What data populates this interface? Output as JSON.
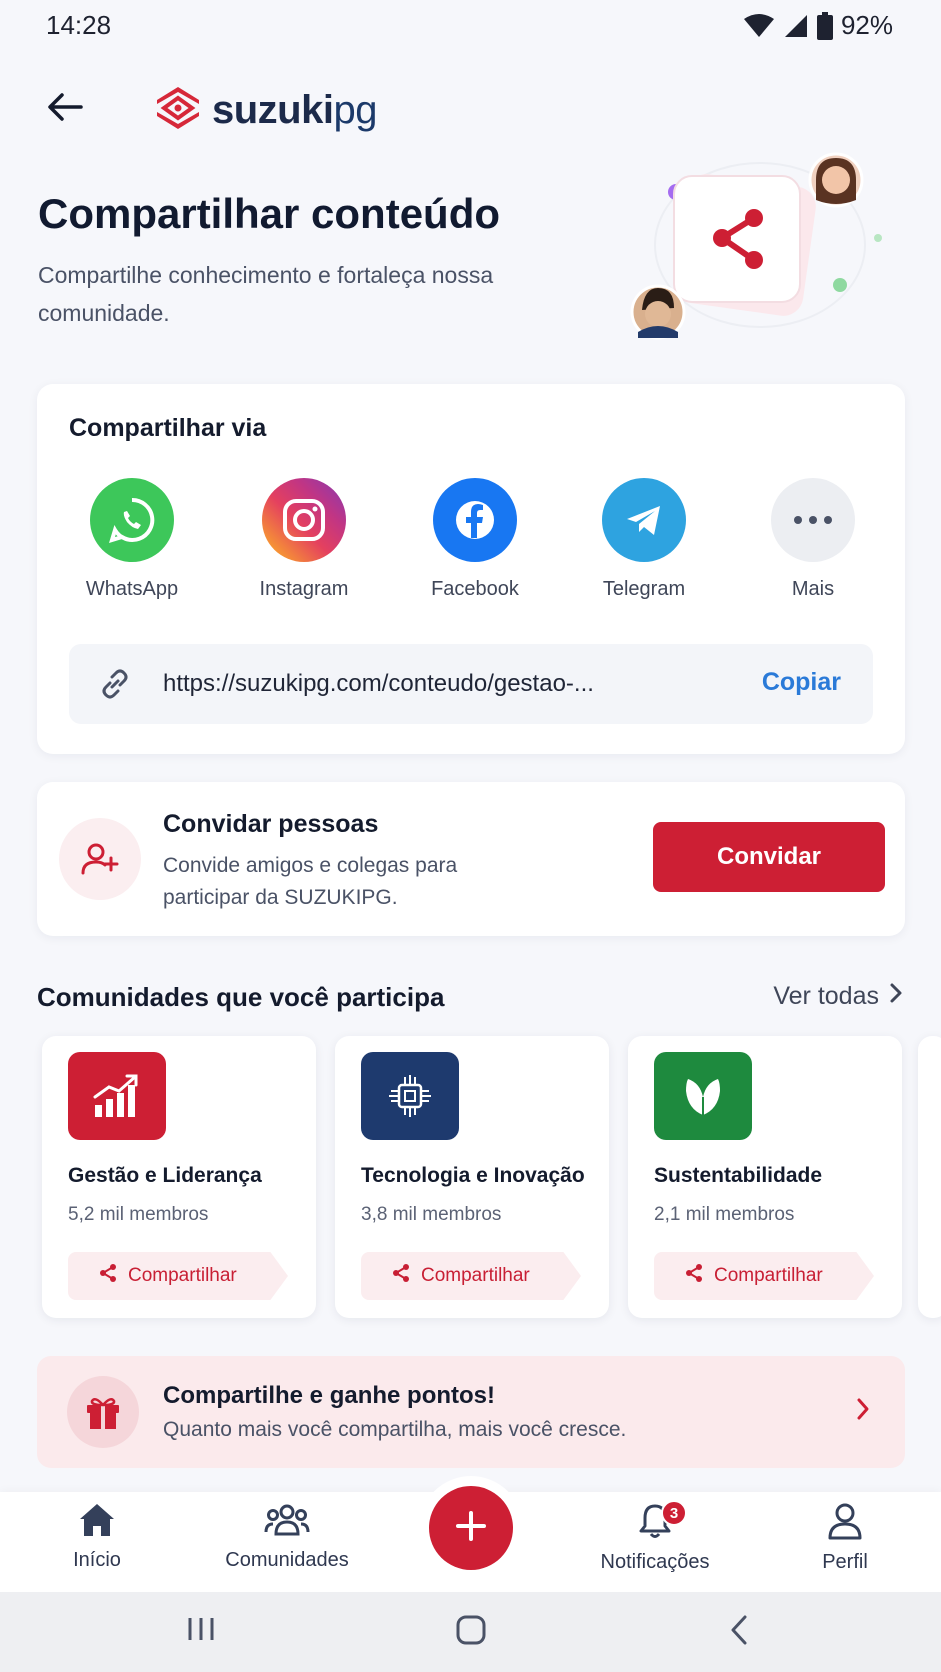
{
  "status": {
    "time": "14:28",
    "battery": "92%"
  },
  "brand": {
    "name_main": "suzuki",
    "name_suffix": "pg"
  },
  "hero": {
    "title": "Compartilhar conteúdo",
    "subtitle": "Compartilhe conhecimento e fortaleça nossa comunidade."
  },
  "share": {
    "title": "Compartilhar via",
    "options": [
      {
        "label": "WhatsApp",
        "icon": "whatsapp-icon",
        "color": "#3dc75a"
      },
      {
        "label": "Instagram",
        "icon": "instagram-icon",
        "color": "#e1306c"
      },
      {
        "label": "Facebook",
        "icon": "facebook-icon",
        "color": "#1877f2"
      },
      {
        "label": "Telegram",
        "icon": "telegram-icon",
        "color": "#2ea3e0"
      },
      {
        "label": "Mais",
        "icon": "more-icon",
        "color": "#eceef2"
      }
    ],
    "link": "https://suzukipg.com/conteudo/gestao-...",
    "copy_label": "Copiar"
  },
  "invite": {
    "title": "Convidar pessoas",
    "description": "Convide amigos e colegas para participar da SUZUKIPG.",
    "button_label": "Convidar"
  },
  "communities": {
    "title": "Comunidades que você participa",
    "see_all": "Ver todas",
    "items": [
      {
        "name": "Gestão e Liderança",
        "members": "5,2 mil membros",
        "share_label": "Compartilhar",
        "icon": "growth-chart-icon",
        "color": "#cd1f34"
      },
      {
        "name": "Tecnologia e Inovação",
        "members": "3,8 mil membros",
        "share_label": "Compartilhar",
        "icon": "chip-icon",
        "color": "#1e3a6e"
      },
      {
        "name": "Sustentabilidade",
        "members": "2,1 mil membros",
        "share_label": "Compartilhar",
        "icon": "leaf-icon",
        "color": "#1e8a3e"
      }
    ]
  },
  "points": {
    "title": "Compartilhe e ganhe pontos!",
    "description": "Quanto mais você compartilha, mais você cresce."
  },
  "nav": {
    "items": [
      {
        "label": "Início",
        "icon": "home-icon"
      },
      {
        "label": "Comunidades",
        "icon": "people-icon"
      },
      {
        "label": "Notificações",
        "icon": "bell-icon",
        "badge": "3"
      },
      {
        "label": "Perfil",
        "icon": "user-icon"
      }
    ]
  },
  "colors": {
    "accent": "#cd1f34",
    "link": "#2a7ad8"
  }
}
